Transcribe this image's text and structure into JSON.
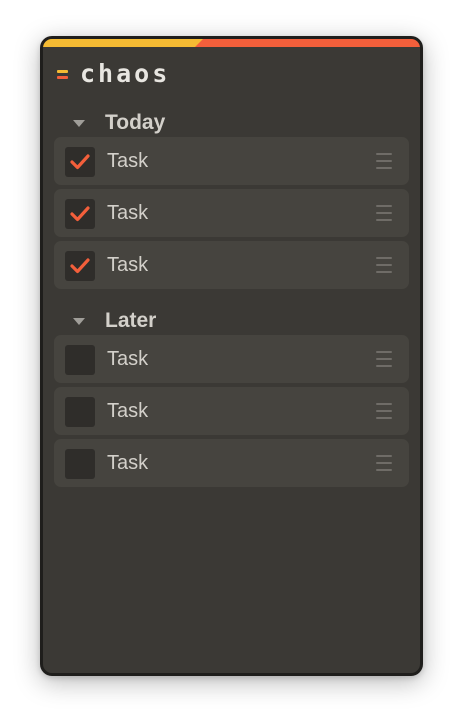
{
  "app": {
    "name": "chaos",
    "colors": {
      "accent_yellow": "#f5bb33",
      "accent_orange": "#f35f3b",
      "background": "#3b3935",
      "row_background": "#46443f"
    }
  },
  "sections": [
    {
      "title": "Today",
      "expanded": true,
      "tasks": [
        {
          "label": "Task",
          "checked": true
        },
        {
          "label": "Task",
          "checked": true
        },
        {
          "label": "Task",
          "checked": true
        }
      ]
    },
    {
      "title": "Later",
      "expanded": true,
      "tasks": [
        {
          "label": "Task",
          "checked": false
        },
        {
          "label": "Task",
          "checked": false
        },
        {
          "label": "Task",
          "checked": false
        }
      ]
    }
  ],
  "icons": {
    "collapse": "caret-down-icon",
    "check": "checkmark-icon",
    "drag": "drag-handle-icon"
  }
}
